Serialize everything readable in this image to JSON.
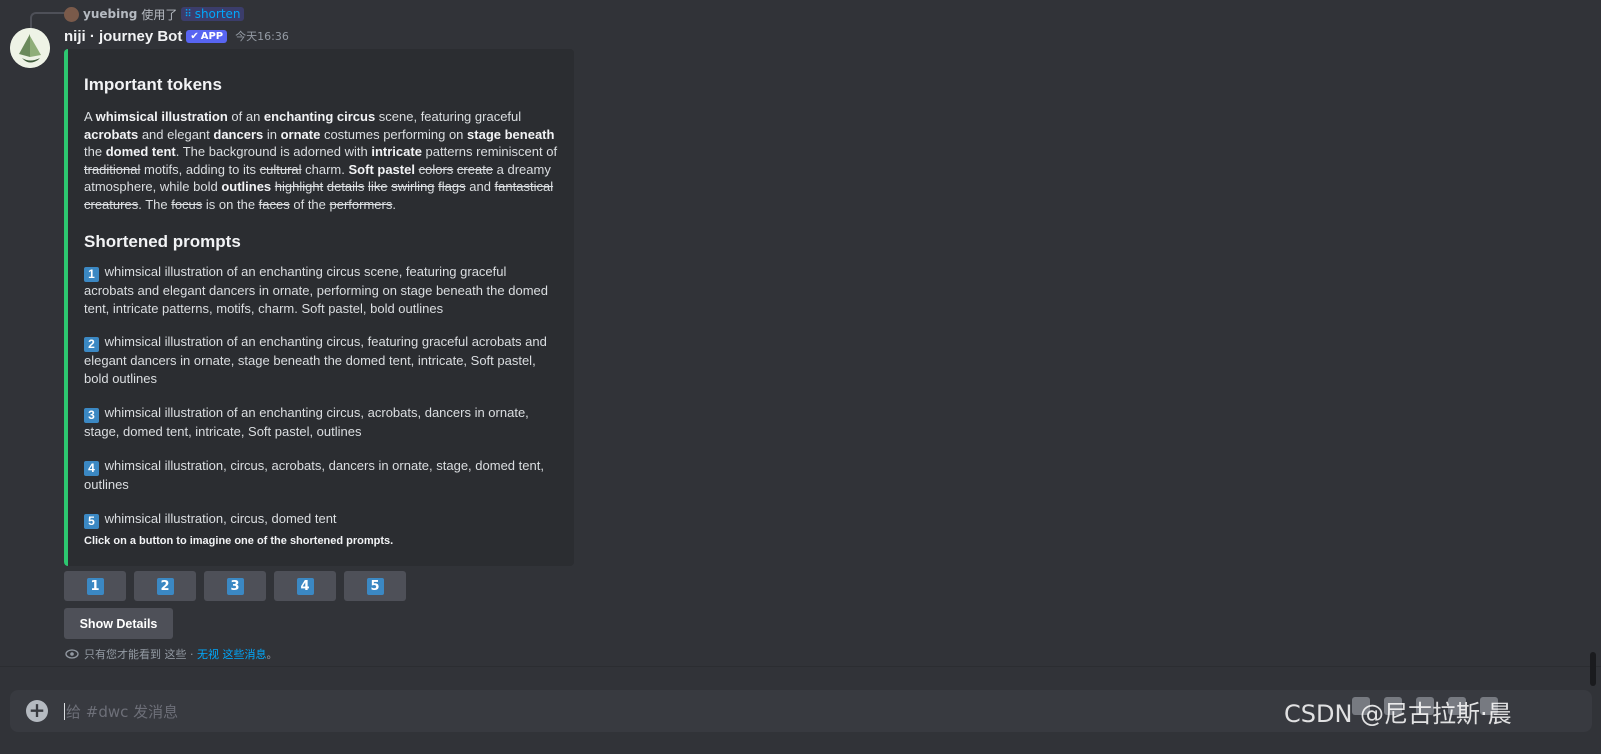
{
  "reply": {
    "user": "yuebing",
    "used": "使用了",
    "command": "shorten"
  },
  "message": {
    "bot_name": "niji · journey Bot",
    "badge": "APP",
    "timestamp": "今天16:36"
  },
  "embed": {
    "accent_color": "#2dc770",
    "title_tokens": "Important tokens",
    "title_prompts": "Shortened prompts",
    "hint": "Click on a button to imagine one of the shortened prompts.",
    "prompts": [
      {
        "num": "1",
        "text": "whimsical illustration of an enchanting circus scene, featuring graceful acrobats and elegant dancers in ornate, performing on stage beneath the domed tent, intricate patterns, motifs, charm. Soft pastel, bold outlines"
      },
      {
        "num": "2",
        "text": "whimsical illustration of an enchanting circus, featuring graceful acrobats and elegant dancers in ornate, stage beneath the domed tent, intricate, Soft pastel, bold outlines"
      },
      {
        "num": "3",
        "text": "whimsical illustration of an enchanting circus, acrobats, dancers in ornate, stage, domed tent, intricate, Soft pastel, outlines"
      },
      {
        "num": "4",
        "text": "whimsical illustration, circus, acrobats, dancers in ornate, stage, domed tent, outlines"
      },
      {
        "num": "5",
        "text": "whimsical illustration, circus, domed tent"
      }
    ]
  },
  "buttons": [
    "1",
    "2",
    "3",
    "4",
    "5"
  ],
  "show_details": "Show Details",
  "ephemeral": {
    "text": "只有您才能看到 这些 · ",
    "link": "无视 这些消息",
    "end": "。"
  },
  "composer": {
    "placeholder": "给 #dwc 发消息"
  },
  "watermark": "CSDN @尼古拉斯·晨"
}
